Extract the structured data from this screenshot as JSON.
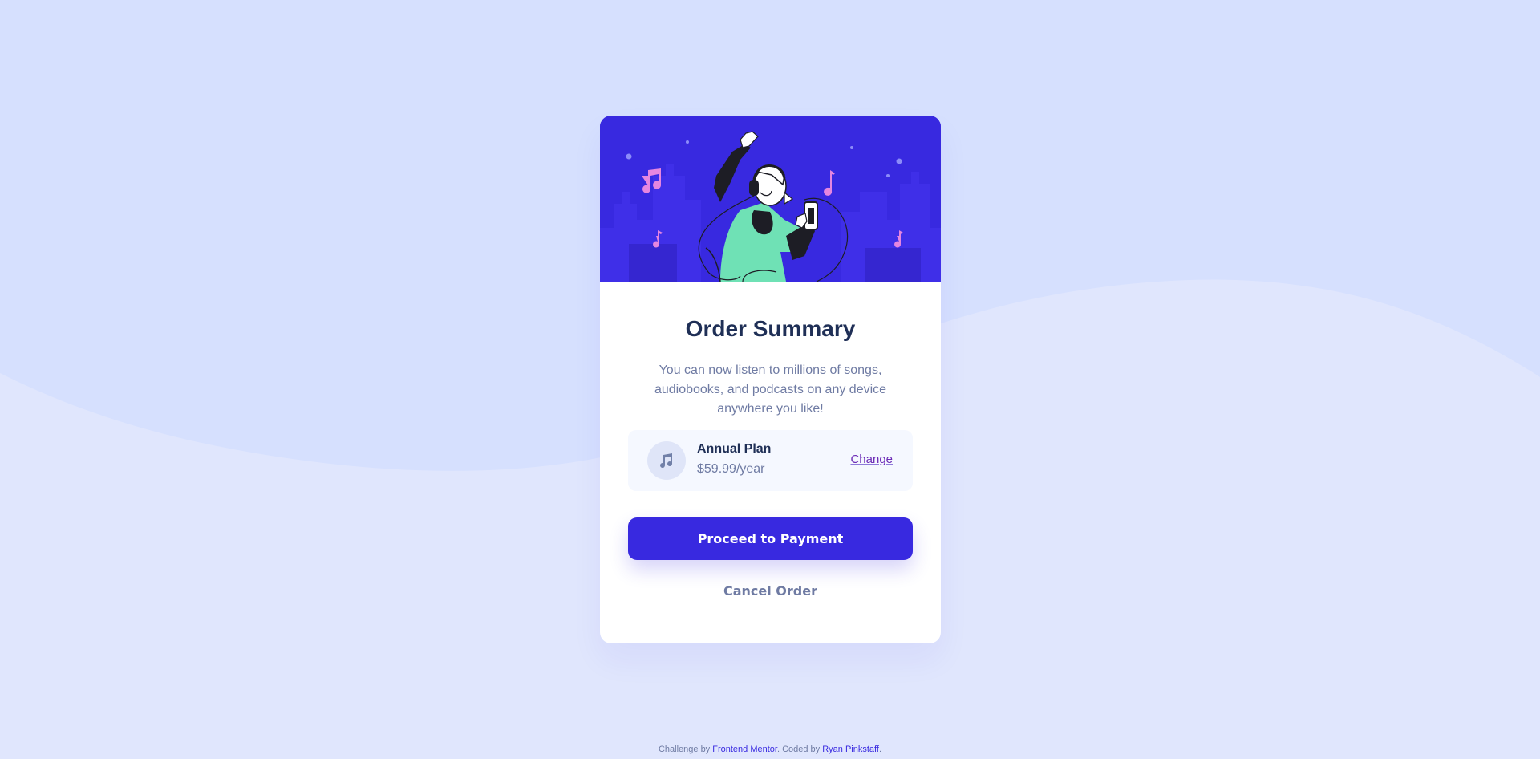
{
  "page": {
    "background_color": "#e0e6fd",
    "wave_color": "#d6e0fe"
  },
  "card": {
    "hero_illustration": "person-dancing-with-headphones-and-phone",
    "title": "Order Summary",
    "description": "You can now listen to millions of songs, audiobooks, and podcasts on any device anywhere you like!",
    "plan": {
      "icon": "music-note-icon",
      "name": "Annual Plan",
      "price": "$59.99/year",
      "change_label": "Change"
    },
    "proceed_label": "Proceed to Payment",
    "cancel_label": "Cancel Order"
  },
  "attribution": {
    "prefix": "Challenge by ",
    "challenge_link": "Frontend Mentor",
    "middle": ". Coded by ",
    "coder_link": "Ryan Pinkstaff",
    "suffix": "."
  },
  "colors": {
    "primary": "#3829e0",
    "title": "#1f2f56",
    "muted": "#6f7ba3",
    "plan_bg": "#f5f8ff"
  }
}
